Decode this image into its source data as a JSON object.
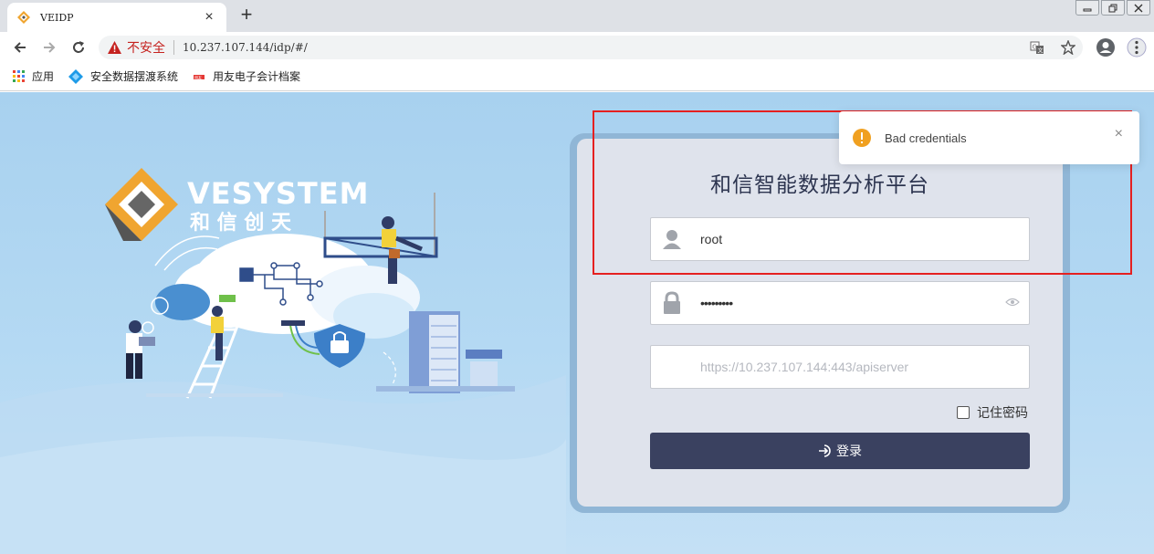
{
  "browser": {
    "tab_title": "VEIDP",
    "tab_close": "×",
    "new_tab": "+",
    "security_label": "不安全",
    "url": "10.237.107.144/idp/#/",
    "bookmarks": [
      {
        "label": "应用"
      },
      {
        "label": "安全数据摆渡系统"
      },
      {
        "label": "用友电子会计档案"
      }
    ]
  },
  "logo": {
    "brand": "VESYSTEM",
    "cn": "和 信 创 天"
  },
  "login": {
    "title": "和信智能数据分析平台",
    "username": "root",
    "password": "•••••••••",
    "server_placeholder": "https://10.237.107.144:443/apiserver",
    "remember": "记住密码",
    "submit": "登录"
  },
  "toast": {
    "message": "Bad credentials",
    "close": "×"
  },
  "colors": {
    "page_bg": "#a8d1ef",
    "panel": "#dfe3ec",
    "button": "#3a4160",
    "highlight": "#e52020",
    "toast_icon": "#f0a020"
  }
}
